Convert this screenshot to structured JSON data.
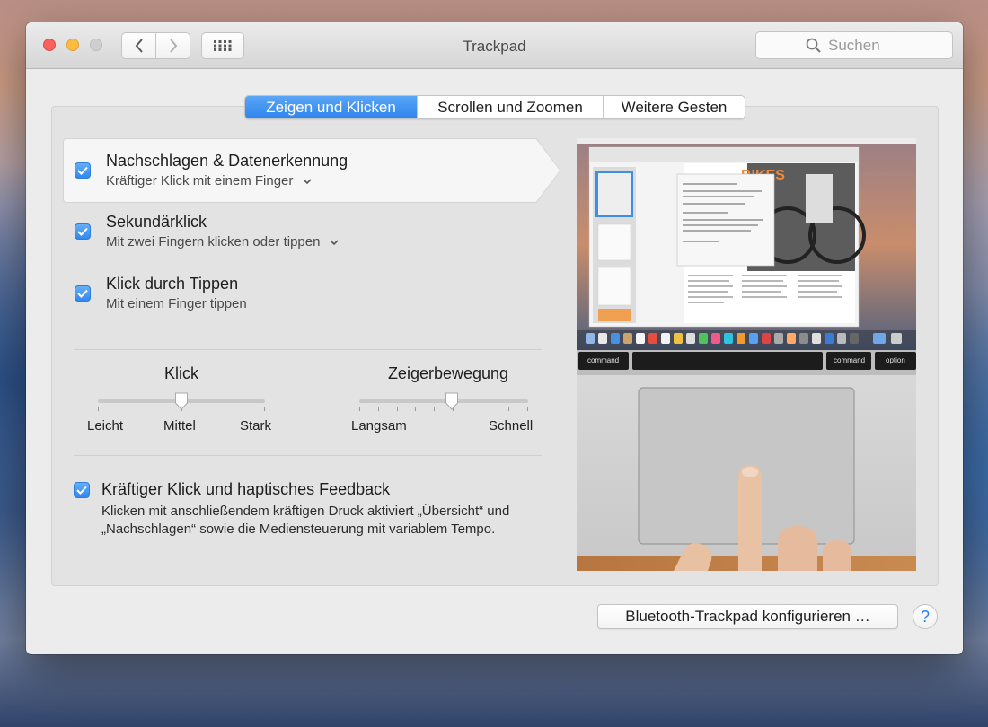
{
  "window": {
    "title": "Trackpad",
    "search_placeholder": "Suchen"
  },
  "tabs": [
    {
      "label": "Zeigen und Klicken",
      "active": true
    },
    {
      "label": "Scrollen und Zoomen",
      "active": false
    },
    {
      "label": "Weitere Gesten",
      "active": false
    }
  ],
  "options": [
    {
      "title": "Nachschlagen & Datenerkennung",
      "subtitle": "Kräftiger Klick mit einem Finger",
      "checked": true,
      "has_menu": true
    },
    {
      "title": "Sekundärklick",
      "subtitle": "Mit zwei Fingern klicken oder tippen",
      "checked": true,
      "has_menu": true
    },
    {
      "title": "Klick durch Tippen",
      "subtitle": "Mit einem Finger tippen",
      "checked": true,
      "has_menu": false
    }
  ],
  "click_slider": {
    "label": "Klick",
    "ticks": [
      "Leicht",
      "Mittel",
      "Stark"
    ],
    "value": "Mittel"
  },
  "pointer_slider": {
    "label": "Zeigerbewegung",
    "min_label": "Langsam",
    "max_label": "Schnell",
    "tick_count": 10,
    "value_fraction": 0.55
  },
  "force_click": {
    "title": "Kräftiger Klick und haptisches Feedback",
    "description": "Klicken mit anschließendem kräftigen Druck aktiviert „Übersicht“ und „Nachschlagen“ sowie die Mediensteuerung mit variablem Tempo.",
    "checked": true
  },
  "preview": {
    "key_left": "command",
    "key_right1": "command",
    "key_right2": "option",
    "doc_headline": "BIKES"
  },
  "footer": {
    "bluetooth_button": "Bluetooth-Trackpad konfigurieren …",
    "help_button": "?"
  },
  "colors": {
    "accent": "#2e84ef",
    "window_bg": "#ececec"
  }
}
